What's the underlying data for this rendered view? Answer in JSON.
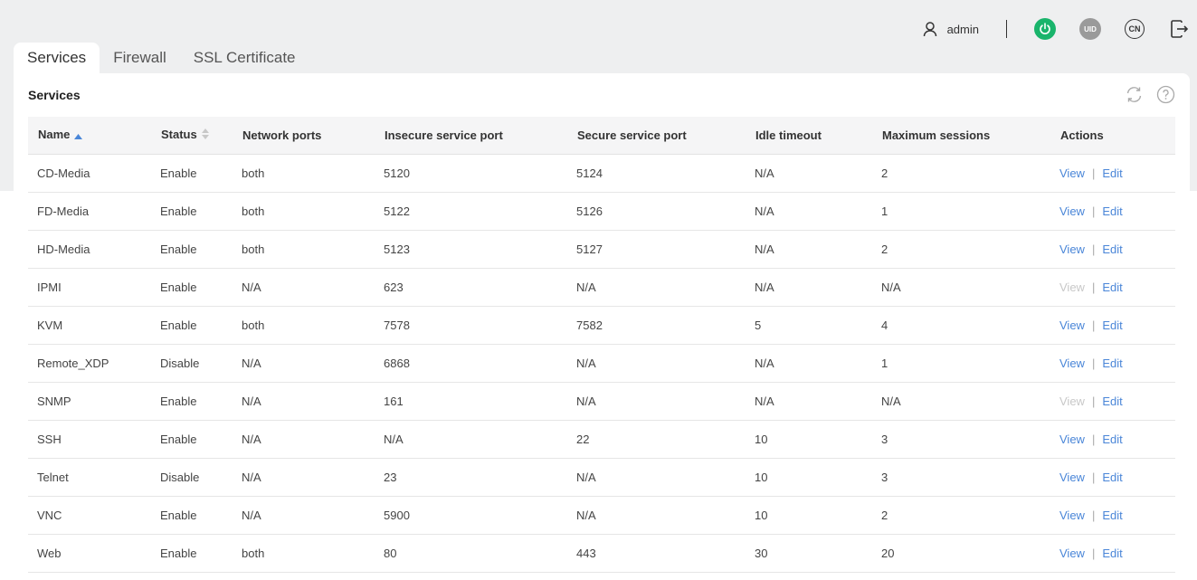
{
  "user": {
    "name": "admin"
  },
  "header_buttons": {
    "uid": "UID",
    "lang": "CN"
  },
  "colors": {
    "power": "#19b46b",
    "link": "#4a86d8",
    "link_disabled": "#c8c8c8"
  },
  "tabs": [
    {
      "label": "Services",
      "active": true
    },
    {
      "label": "Firewall",
      "active": false
    },
    {
      "label": "SSL Certificate",
      "active": false
    }
  ],
  "panel": {
    "title": "Services"
  },
  "table": {
    "columns": [
      "Name",
      "Status",
      "Network ports",
      "Insecure service port",
      "Secure service port",
      "Idle timeout",
      "Maximum sessions",
      "Actions"
    ],
    "view_label": "View",
    "edit_label": "Edit",
    "separator": "|",
    "rows": [
      {
        "name": "CD-Media",
        "status": "Enable",
        "network": "both",
        "insecure": "5120",
        "secure": "5124",
        "idle": "N/A",
        "max": "2",
        "view_enabled": true
      },
      {
        "name": "FD-Media",
        "status": "Enable",
        "network": "both",
        "insecure": "5122",
        "secure": "5126",
        "idle": "N/A",
        "max": "1",
        "view_enabled": true
      },
      {
        "name": "HD-Media",
        "status": "Enable",
        "network": "both",
        "insecure": "5123",
        "secure": "5127",
        "idle": "N/A",
        "max": "2",
        "view_enabled": true
      },
      {
        "name": "IPMI",
        "status": "Enable",
        "network": "N/A",
        "insecure": "623",
        "secure": "N/A",
        "idle": "N/A",
        "max": "N/A",
        "view_enabled": false
      },
      {
        "name": "KVM",
        "status": "Enable",
        "network": "both",
        "insecure": "7578",
        "secure": "7582",
        "idle": "5",
        "max": "4",
        "view_enabled": true
      },
      {
        "name": "Remote_XDP",
        "status": "Disable",
        "network": "N/A",
        "insecure": "6868",
        "secure": "N/A",
        "idle": "N/A",
        "max": "1",
        "view_enabled": true
      },
      {
        "name": "SNMP",
        "status": "Enable",
        "network": "N/A",
        "insecure": "161",
        "secure": "N/A",
        "idle": "N/A",
        "max": "N/A",
        "view_enabled": false
      },
      {
        "name": "SSH",
        "status": "Enable",
        "network": "N/A",
        "insecure": "N/A",
        "secure": "22",
        "idle": "10",
        "max": "3",
        "view_enabled": true
      },
      {
        "name": "Telnet",
        "status": "Disable",
        "network": "N/A",
        "insecure": "23",
        "secure": "N/A",
        "idle": "10",
        "max": "3",
        "view_enabled": true
      },
      {
        "name": "VNC",
        "status": "Enable",
        "network": "N/A",
        "insecure": "5900",
        "secure": "N/A",
        "idle": "10",
        "max": "2",
        "view_enabled": true
      },
      {
        "name": "Web",
        "status": "Enable",
        "network": "both",
        "insecure": "80",
        "secure": "443",
        "idle": "30",
        "max": "20",
        "view_enabled": true
      }
    ]
  }
}
